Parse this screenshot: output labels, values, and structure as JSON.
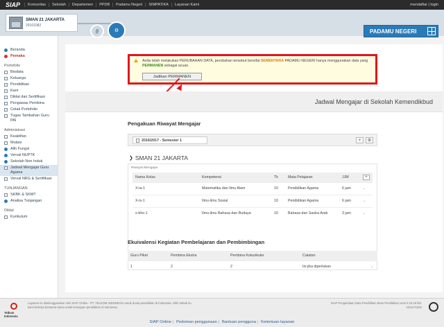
{
  "topbar": {
    "logo": "SIAP",
    "nav": [
      "Komunitas",
      "Sekolah",
      "Departemen",
      "PPDB",
      "Padamu Negeri",
      "SIMPATIKA",
      "Layanan Kami"
    ],
    "user_links": "mendaftar | login"
  },
  "header": {
    "school_name": "SMAN 21 JAKARTA",
    "school_code": "20101082",
    "step1_icon": "chart-icon",
    "step2_icon": "gear-icon",
    "brand": "PADAMU NEGERI"
  },
  "sidebar": {
    "top_items": [
      {
        "label": "Beranda"
      },
      {
        "label": "Pemaka"
      }
    ],
    "sec_portfolio": "Portofolio",
    "portfolio_items": [
      {
        "label": "Biodata"
      },
      {
        "label": "Keluarga"
      },
      {
        "label": "Pendidikan"
      },
      {
        "label": "Karir"
      },
      {
        "label": "Diklat dan Sertifikasi"
      },
      {
        "label": "Pengawas Pembina"
      },
      {
        "label": "Cetak Portofolio"
      },
      {
        "label": "Tugas Tambahan Guru PAI"
      }
    ],
    "sec_admin": "Administrasi",
    "admin_items": [
      {
        "label": "Keaktifan"
      },
      {
        "label": "Mutasi"
      },
      {
        "label": "Alih Fungsi"
      },
      {
        "label": "Verval NUPTK"
      },
      {
        "label": "Sekolah Non Induk"
      },
      {
        "label": "Jadwal Mengajar Guru Agama"
      },
      {
        "label": "Verval NRG & Sertifikasi"
      }
    ],
    "sec_tunjangan": "TUNJANGAN",
    "tunjangan_items": [
      {
        "label": "SKBK & SKMT"
      },
      {
        "label": "Analisa Tunjangan"
      }
    ],
    "sec_diklat": "Diklat",
    "diklat_items": [
      {
        "label": "Kurikulum"
      }
    ]
  },
  "alert": {
    "msg_a": "Anda telah melakukan PERUBAHAN DATA, perubahan tersebut bersifat ",
    "msg_hl": "SEMENTARA",
    "msg_b": " PADAMU NEGERI hanya menggunakan data yang ",
    "msg_hl2": "PERMANEN",
    "msg_c": " sebagai acuan.",
    "button": "Jadikan PERMANEN"
  },
  "page": {
    "title": "Jadwal Mengajar di Sekolah Kemendikbud",
    "sec1_title": "Pengakuan Riwayat Mengajar",
    "period_tab": "2016/2017 - Semester 1",
    "school_heading": "SMAN 21 JAKARTA",
    "rw_label": "Riwayat Mengajar",
    "sec2_title": "Ekuivalensi Kegiatan Pembelajaran dan Pembimbingan"
  },
  "riwayat_table": {
    "headers": [
      "Nama Kelas",
      "Kompetensi",
      "Tk",
      "Mata Pelajaran",
      "JJM",
      "+"
    ],
    "rows": [
      [
        "X-ia-1",
        "Matematika dan Ilmu Alam",
        "10",
        "Pendidikan Agama",
        "6 jam"
      ],
      [
        "X-is-1",
        "Ilmu-ilmu Sosial",
        "10",
        "Pendidikan Agama",
        "6 jam"
      ],
      [
        "x-bhs-1",
        "Ilmu-ilmu Bahasa dan Budaya",
        "10",
        "Bahasa dan Sastra Arab",
        "3 jam"
      ]
    ]
  },
  "ekuivalensi_table": {
    "headers": [
      "Guru Piket",
      "Pembina Ekstra",
      "Pembina Kokurikuler",
      "Catatan"
    ],
    "rows": [
      [
        "1",
        "2",
        "2",
        "Ini jika diperlukan"
      ]
    ]
  },
  "footer": {
    "left_logo_text": "Telkom Indonesia",
    "left_text": "Layanan ini diselenggarakan oleh SIAP Online - PT. TELKOM INDONESIA untuk dunia pendidikan di Indonesia. Oleh sebab itu kami bekerja bersama-sama untuk kemajuan pendidikan di Indonesia.",
    "right_text": "SIAP Pengelolaan Data Pendidikan Mutu Pendidikan versi 5.10.19 bld. 1611171922",
    "links": [
      "SIAP Online",
      "Pedoman penggunaan",
      "Bantuan pengguna",
      "Ketentuan layanan"
    ]
  },
  "colors": {
    "accent": "#2a7ab7",
    "alert_border": "#e0161d",
    "highlight": "#e07b00"
  }
}
